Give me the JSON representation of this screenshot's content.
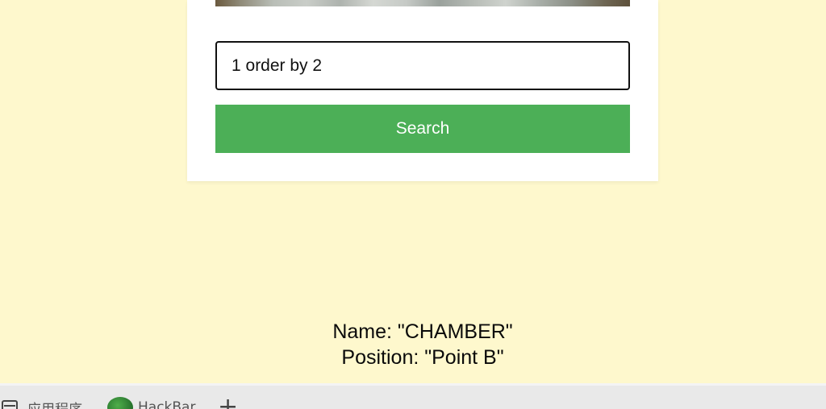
{
  "search": {
    "value": "1 order by 2",
    "button_label": "Search"
  },
  "result": {
    "name_line": "Name: \"CHAMBER\"",
    "position_line": "Position: \"Point B\""
  },
  "bookmarks": {
    "apps_label": "应用程序",
    "hackbar_label": "HackBar",
    "add_label": "+"
  },
  "colors": {
    "page_background": "#fef8cd",
    "button_green": "#4caf57"
  }
}
